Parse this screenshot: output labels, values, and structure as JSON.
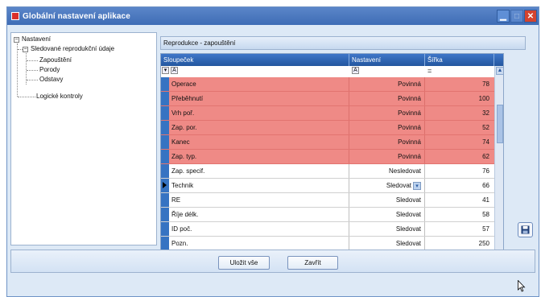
{
  "window": {
    "title": "Globální nastavení aplikace"
  },
  "tree": {
    "root": "Nastavení",
    "child": "Sledované reprodukční údaje",
    "leaves": [
      "Zapouštění",
      "Porody",
      "Odstavy"
    ],
    "sibling": "Logické kontroly"
  },
  "panel": {
    "title": "Reprodukce - zapouštění"
  },
  "grid": {
    "columns": [
      "Sloupeček",
      "Nastavení",
      "Šířka"
    ],
    "rows": [
      {
        "name": "Operace",
        "setting": "Povinná",
        "width": "78",
        "required": true
      },
      {
        "name": "Přeběhnutí",
        "setting": "Povinná",
        "width": "100",
        "required": true
      },
      {
        "name": "Vrh poř.",
        "setting": "Povinná",
        "width": "32",
        "required": true
      },
      {
        "name": "Zap. por.",
        "setting": "Povinná",
        "width": "52",
        "required": true
      },
      {
        "name": "Kanec",
        "setting": "Povinná",
        "width": "74",
        "required": true
      },
      {
        "name": "Zap. typ.",
        "setting": "Povinná",
        "width": "62",
        "required": true
      },
      {
        "name": "Zap. specif.",
        "setting": "Nesledovat",
        "width": "76",
        "required": false
      },
      {
        "name": "Technik",
        "setting": "Sledovat",
        "width": "66",
        "required": false,
        "current": true
      },
      {
        "name": "RE",
        "setting": "Sledovat",
        "width": "41",
        "required": false
      },
      {
        "name": "Říje délk.",
        "setting": "Sledovat",
        "width": "58",
        "required": false
      },
      {
        "name": "ID poč.",
        "setting": "Sledovat",
        "width": "57",
        "required": false
      },
      {
        "name": "Pozn.",
        "setting": "Sledovat",
        "width": "250",
        "required": false
      }
    ],
    "filter_eq": "="
  },
  "buttons": {
    "save_all": "Uložit vše",
    "close": "Zavřít"
  },
  "colors": {
    "required_row": "#ef8a86",
    "header": "#2f65b3",
    "titlebar": "#4a78c0"
  },
  "icons": [
    "app-icon",
    "minimize-icon",
    "maximize-icon",
    "close-icon",
    "save-disk-icon",
    "filter-icon",
    "dropdown-arrow-icon",
    "scroll-up-icon",
    "scroll-down-icon",
    "mouse-cursor-icon"
  ]
}
